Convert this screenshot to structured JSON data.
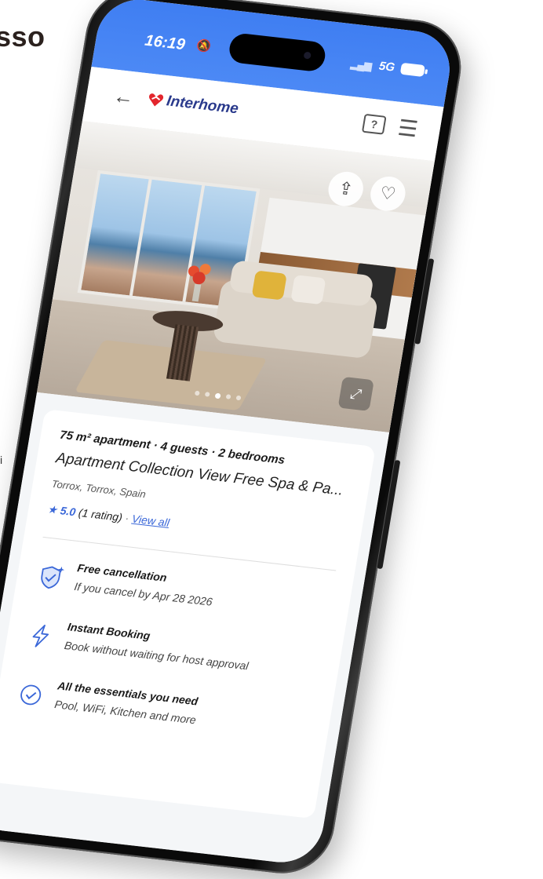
{
  "background": {
    "heading": "sso",
    "side_letter": "i"
  },
  "status_bar": {
    "time": "16:19",
    "network": "5G"
  },
  "nav": {
    "brand": "Interhome"
  },
  "listing": {
    "specs": "75 m² apartment · 4 guests · 2 bedrooms",
    "title": "Apartment Collection View Free Spa & Pa...",
    "location": "Torrox, Torrox, Spain",
    "rating_star": "★",
    "rating_score": "5.0",
    "rating_count": "(1 rating)",
    "rating_separator": " · ",
    "view_all": "View all"
  },
  "features": [
    {
      "title": "Free cancellation",
      "description": "If you cancel by Apr 28 2026",
      "icon": "shield-check-icon"
    },
    {
      "title": "Instant Booking",
      "description": "Book without waiting for host approval",
      "icon": "lightning-icon"
    },
    {
      "title": "All the essentials you need",
      "description": "Pool, WiFi, Kitchen and more",
      "icon": "check-circle-icon"
    }
  ],
  "colors": {
    "status_bar_blue": "#4c89f5",
    "accent_blue": "#3a67d8",
    "brand_red": "#e3262d",
    "brand_navy": "#2a3a8c"
  }
}
